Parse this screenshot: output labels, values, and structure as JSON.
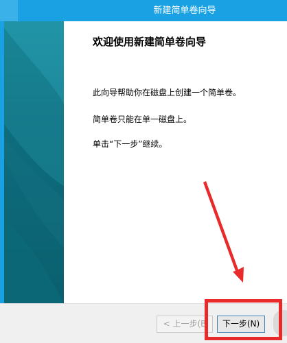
{
  "window": {
    "title": "新建简单卷向导"
  },
  "page": {
    "heading": "欢迎使用新建简单卷向导",
    "paragraphs": [
      "此向导帮助你在磁盘上创建一个简单卷。",
      "简单卷只能在单一磁盘上。",
      "单击“下一步”继续。"
    ]
  },
  "buttons": {
    "back_label": "< 上一步(B",
    "next_label": "下一步(N)"
  },
  "colors": {
    "titlebar": "#1aa1e4",
    "sidebar": "#0e6e7e",
    "annotation": "#e82a2a"
  },
  "icons": {
    "annotation_arrow": "red-arrow-icon"
  }
}
